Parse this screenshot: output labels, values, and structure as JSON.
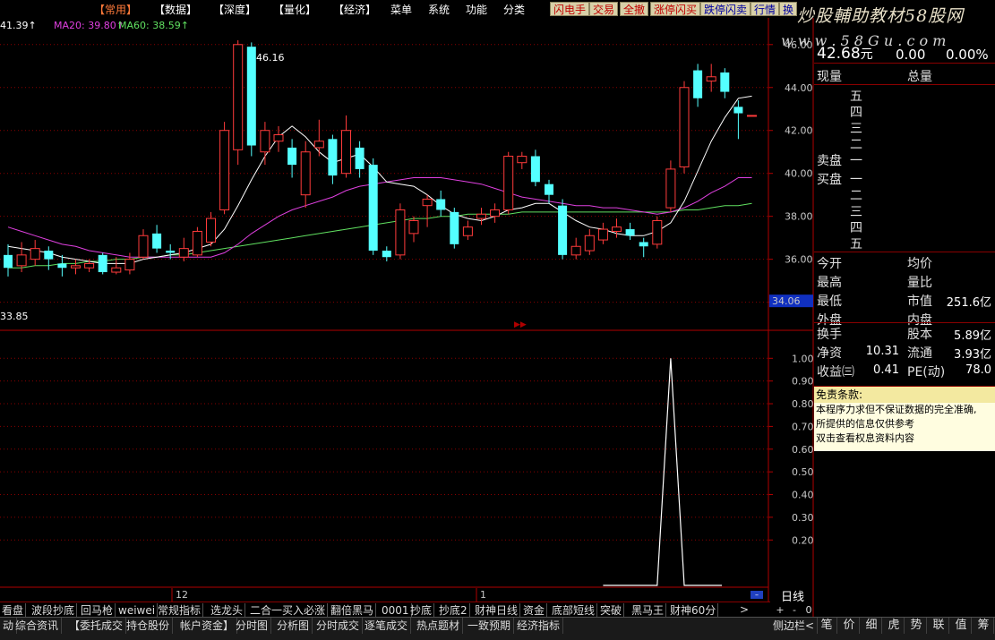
{
  "menu": {
    "items": [
      {
        "label": "【常用】",
        "x": 105,
        "active": true
      },
      {
        "label": "【数据】",
        "x": 172
      },
      {
        "label": "【深度】",
        "x": 238
      },
      {
        "label": "【量化】",
        "x": 305
      },
      {
        "label": "【经济】",
        "x": 372
      },
      {
        "label": "菜单",
        "x": 436
      },
      {
        "label": "系统",
        "x": 478
      },
      {
        "label": "功能",
        "x": 520
      },
      {
        "label": "分类",
        "x": 562
      }
    ],
    "toolbar": [
      {
        "label": "闪电手",
        "x": 614,
        "color": "red"
      },
      {
        "label": "交易",
        "x": 658,
        "color": "red"
      },
      {
        "label": "全撤",
        "x": 692,
        "color": "red"
      },
      {
        "label": "涨停闪买",
        "x": 726,
        "color": "red"
      },
      {
        "label": "跌停闪卖",
        "x": 782,
        "color": "blue"
      },
      {
        "label": "行情",
        "x": 838,
        "color": "blue"
      },
      {
        "label": "换",
        "x": 870,
        "color": "blue"
      }
    ]
  },
  "watermark": {
    "line1": "炒股輔助教材58股网",
    "line2": "w w w . 5 8 G u . c o m"
  },
  "ma_legend": {
    "ma10": "41.39↑",
    "ma20": "MA20: 39.80↑",
    "ma60": "MA60: 38.59↑"
  },
  "colors": {
    "up": "#ff3b3b",
    "down": "#54ffff",
    "ma10": "#ffffff",
    "ma20": "#e040e0",
    "ma60": "#60e060",
    "grid": "#8a0000",
    "axis": "#b00000"
  },
  "chart_data": [
    {
      "type": "candlestick",
      "panel": "price",
      "ylim": [
        34,
        46
      ],
      "y_ticks": [
        "46.00",
        "44.00",
        "42.00",
        "40.00",
        "38.00",
        "36.00",
        "34.00"
      ],
      "current_price_tag": "34.06",
      "high_label": "46.16",
      "low_label": "33.85",
      "x_labels": [
        "12",
        "1"
      ],
      "candles": [
        {
          "o": 36.2,
          "c": 35.6,
          "h": 36.7,
          "l": 35.2
        },
        {
          "o": 35.7,
          "c": 36.2,
          "h": 36.8,
          "l": 35.4
        },
        {
          "o": 36.0,
          "c": 36.5,
          "h": 36.9,
          "l": 35.7
        },
        {
          "o": 36.4,
          "c": 36.0,
          "h": 36.6,
          "l": 35.5
        },
        {
          "o": 35.8,
          "c": 35.6,
          "h": 36.2,
          "l": 35.2
        },
        {
          "o": 35.6,
          "c": 35.7,
          "h": 36.0,
          "l": 35.3
        },
        {
          "o": 35.6,
          "c": 35.8,
          "h": 36.0,
          "l": 35.4
        },
        {
          "o": 36.2,
          "c": 35.4,
          "h": 36.3,
          "l": 35.3
        },
        {
          "o": 35.4,
          "c": 35.6,
          "h": 36.1,
          "l": 35.3
        },
        {
          "o": 35.5,
          "c": 36.0,
          "h": 36.3,
          "l": 35.3
        },
        {
          "o": 36.1,
          "c": 37.1,
          "h": 37.4,
          "l": 36.0
        },
        {
          "o": 37.2,
          "c": 36.5,
          "h": 37.6,
          "l": 36.3
        },
        {
          "o": 36.4,
          "c": 36.3,
          "h": 36.7,
          "l": 36.0
        },
        {
          "o": 36.1,
          "c": 36.5,
          "h": 37.0,
          "l": 35.9
        },
        {
          "o": 36.2,
          "c": 37.3,
          "h": 37.5,
          "l": 36.1
        },
        {
          "o": 36.8,
          "c": 37.9,
          "h": 38.2,
          "l": 36.6
        },
        {
          "o": 38.3,
          "c": 42.0,
          "h": 42.4,
          "l": 38.1
        },
        {
          "o": 41.1,
          "c": 46.0,
          "h": 46.2,
          "l": 40.4
        },
        {
          "o": 45.9,
          "c": 41.3,
          "h": 46.1,
          "l": 40.8
        },
        {
          "o": 41.0,
          "c": 42.0,
          "h": 42.4,
          "l": 40.4
        },
        {
          "o": 41.5,
          "c": 41.8,
          "h": 42.2,
          "l": 41.0
        },
        {
          "o": 41.2,
          "c": 40.4,
          "h": 41.6,
          "l": 39.8
        },
        {
          "o": 39.0,
          "c": 41.0,
          "h": 41.5,
          "l": 38.4
        },
        {
          "o": 41.2,
          "c": 41.5,
          "h": 42.5,
          "l": 40.8
        },
        {
          "o": 41.6,
          "c": 39.9,
          "h": 41.8,
          "l": 39.5
        },
        {
          "o": 40.0,
          "c": 42.0,
          "h": 42.7,
          "l": 39.8
        },
        {
          "o": 41.2,
          "c": 40.2,
          "h": 41.5,
          "l": 39.8
        },
        {
          "o": 40.4,
          "c": 36.4,
          "h": 40.7,
          "l": 36.2
        },
        {
          "o": 36.4,
          "c": 36.1,
          "h": 36.6,
          "l": 35.9
        },
        {
          "o": 36.2,
          "c": 38.3,
          "h": 38.6,
          "l": 36.0
        },
        {
          "o": 37.2,
          "c": 37.8,
          "h": 38.0,
          "l": 36.8
        },
        {
          "o": 38.5,
          "c": 38.8,
          "h": 39.0,
          "l": 37.5
        },
        {
          "o": 38.8,
          "c": 38.3,
          "h": 39.2,
          "l": 38.0
        },
        {
          "o": 38.2,
          "c": 36.7,
          "h": 38.4,
          "l": 36.5
        },
        {
          "o": 37.1,
          "c": 37.5,
          "h": 37.8,
          "l": 36.9
        },
        {
          "o": 37.9,
          "c": 38.1,
          "h": 38.4,
          "l": 37.6
        },
        {
          "o": 38.0,
          "c": 38.3,
          "h": 38.6,
          "l": 37.7
        },
        {
          "o": 38.3,
          "c": 40.8,
          "h": 41.0,
          "l": 38.1
        },
        {
          "o": 40.5,
          "c": 40.8,
          "h": 41.0,
          "l": 40.2
        },
        {
          "o": 40.8,
          "c": 39.6,
          "h": 41.1,
          "l": 39.4
        },
        {
          "o": 39.5,
          "c": 39.0,
          "h": 39.7,
          "l": 38.6
        },
        {
          "o": 38.5,
          "c": 36.2,
          "h": 38.8,
          "l": 36.0
        },
        {
          "o": 36.2,
          "c": 36.6,
          "h": 37.0,
          "l": 36.0
        },
        {
          "o": 36.4,
          "c": 37.1,
          "h": 37.4,
          "l": 36.2
        },
        {
          "o": 36.9,
          "c": 37.4,
          "h": 37.7,
          "l": 36.7
        },
        {
          "o": 37.3,
          "c": 37.5,
          "h": 37.9,
          "l": 37.0
        },
        {
          "o": 37.4,
          "c": 37.1,
          "h": 37.7,
          "l": 36.9
        },
        {
          "o": 36.8,
          "c": 36.6,
          "h": 37.0,
          "l": 36.1
        },
        {
          "o": 36.7,
          "c": 37.8,
          "h": 38.0,
          "l": 36.5
        },
        {
          "o": 38.4,
          "c": 40.2,
          "h": 40.6,
          "l": 38.2
        },
        {
          "o": 40.3,
          "c": 44.0,
          "h": 44.3,
          "l": 40.0
        },
        {
          "o": 44.8,
          "c": 43.5,
          "h": 45.1,
          "l": 43.1
        },
        {
          "o": 44.3,
          "c": 44.5,
          "h": 45.1,
          "l": 43.8
        },
        {
          "o": 44.7,
          "c": 43.8,
          "h": 44.9,
          "l": 43.5
        },
        {
          "o": 43.1,
          "c": 42.8,
          "h": 43.4,
          "l": 41.6
        },
        {
          "o": 42.7,
          "c": 42.7,
          "h": 42.7,
          "l": 42.7
        }
      ],
      "ma10": [
        36.6,
        36.5,
        36.4,
        36.3,
        36.1,
        36.0,
        35.9,
        35.8,
        35.8,
        35.8,
        36.0,
        36.1,
        36.2,
        36.3,
        36.5,
        36.7,
        37.4,
        38.5,
        39.7,
        40.8,
        41.7,
        42.2,
        41.7,
        41.0,
        40.5,
        40.7,
        40.9,
        40.3,
        39.6,
        39.5,
        39.4,
        39.0,
        38.5,
        38.1,
        37.9,
        37.8,
        38.0,
        38.3,
        38.4,
        38.6,
        38.6,
        38.2,
        37.8,
        37.5,
        37.4,
        37.2,
        37.1,
        37.1,
        37.3,
        37.7,
        38.7,
        40.1,
        41.5,
        42.6,
        43.5,
        43.6
      ],
      "ma20": [
        37.5,
        37.3,
        37.1,
        36.9,
        36.7,
        36.6,
        36.4,
        36.3,
        36.2,
        36.1,
        36.1,
        36.1,
        36.1,
        36.1,
        36.1,
        36.1,
        36.3,
        36.7,
        37.2,
        37.6,
        38.0,
        38.3,
        38.5,
        38.7,
        38.9,
        39.2,
        39.4,
        39.5,
        39.6,
        39.7,
        39.8,
        39.8,
        39.8,
        39.7,
        39.6,
        39.5,
        39.3,
        39.1,
        38.9,
        38.8,
        38.7,
        38.6,
        38.5,
        38.5,
        38.4,
        38.4,
        38.3,
        38.2,
        38.1,
        38.2,
        38.4,
        38.7,
        39.1,
        39.4,
        39.8,
        39.8
      ],
      "ma60": [
        35.6,
        35.6,
        35.7,
        35.7,
        35.8,
        35.8,
        35.9,
        35.9,
        36.0,
        36.0,
        36.1,
        36.1,
        36.2,
        36.2,
        36.3,
        36.4,
        36.5,
        36.6,
        36.7,
        36.8,
        36.9,
        37.0,
        37.1,
        37.2,
        37.3,
        37.4,
        37.5,
        37.6,
        37.7,
        37.8,
        37.9,
        37.9,
        38.0,
        38.0,
        38.1,
        38.1,
        38.1,
        38.1,
        38.2,
        38.2,
        38.2,
        38.2,
        38.2,
        38.2,
        38.2,
        38.2,
        38.2,
        38.2,
        38.2,
        38.2,
        38.3,
        38.3,
        38.4,
        38.5,
        38.5,
        38.6
      ]
    },
    {
      "type": "line",
      "panel": "indicator",
      "ylim": [
        0,
        1.1
      ],
      "y_ticks": [
        "1.00",
        "0.90",
        "0.80",
        "0.70",
        "0.60",
        "0.50",
        "0.40",
        "0.30",
        "0.20"
      ],
      "values": [
        0,
        0,
        0,
        0,
        0,
        0,
        0,
        0,
        0,
        0,
        0,
        0,
        0,
        0,
        0,
        0,
        0,
        0,
        0,
        0,
        0,
        0,
        0,
        0,
        0,
        0,
        0,
        0,
        0,
        0,
        0,
        0,
        0,
        0,
        0,
        0,
        0,
        0,
        0,
        0,
        0,
        0,
        0,
        0,
        0,
        0,
        0,
        0,
        0,
        1,
        0,
        0,
        0,
        0,
        0,
        0
      ]
    }
  ],
  "quote": {
    "price": "42.68",
    "price_unit": "元",
    "change": "0.00",
    "pct": "0.00%",
    "col1": "现量",
    "col2": "总量",
    "sell_label": "卖盘",
    "buy_label": "买盘",
    "sell_levels": [
      "五",
      "四",
      "三",
      "二",
      "一"
    ],
    "buy_levels": [
      "一",
      "二",
      "三",
      "四",
      "五"
    ],
    "stats": [
      {
        "l1": "今开",
        "v1": "",
        "l2": "均价",
        "v2": ""
      },
      {
        "l1": "最高",
        "v1": "",
        "l2": "量比",
        "v2": ""
      },
      {
        "l1": "最低",
        "v1": "",
        "l2": "市值",
        "v2": "251.6亿"
      },
      {
        "l1": "外盘",
        "v1": "",
        "l2": "内盘",
        "v2": ""
      }
    ],
    "stats2": [
      {
        "l1": "换手",
        "v1": "",
        "l2": "股本",
        "v2": "5.89亿"
      },
      {
        "l1": "净资",
        "v1": "10.31",
        "l2": "流通",
        "v2": "3.93亿"
      },
      {
        "l1": "收益㈢",
        "v1": "0.41",
        "l2": "PE(动)",
        "v2": "78.0"
      }
    ]
  },
  "notice": {
    "head": "免责条款:",
    "lines": [
      "本程序力求但不保证数据的完全准确,",
      "所提供的信息仅供参考",
      "双击查看权息资料内容"
    ]
  },
  "indicator_tabs": [
    "看盘",
    "波段抄底",
    "回马枪",
    "weiwei",
    "常规指标",
    "选龙头",
    "二合一买入必涨",
    "翻倍黑马",
    "0001",
    "抄底",
    "抄底2",
    "财神日线",
    "资金",
    "底部短线",
    "突破",
    "黑马王",
    "财神60分"
  ],
  "period_label": "日线",
  "scroll_right": ">",
  "mini_btns": [
    "+",
    "-",
    "0"
  ],
  "bottom_tabs": [
    "动",
    "综合资讯",
    "【委托成交",
    "持仓股份",
    "帐户资金】",
    "分时图",
    "分析图",
    "分时成交",
    "逐笔成交",
    "热点题材",
    "一致预期",
    "经济指标"
  ],
  "side_label": "侧边栏<",
  "right_tabs": [
    "笔",
    "价",
    "细",
    "虎",
    "势",
    "联",
    "值",
    "筹"
  ]
}
